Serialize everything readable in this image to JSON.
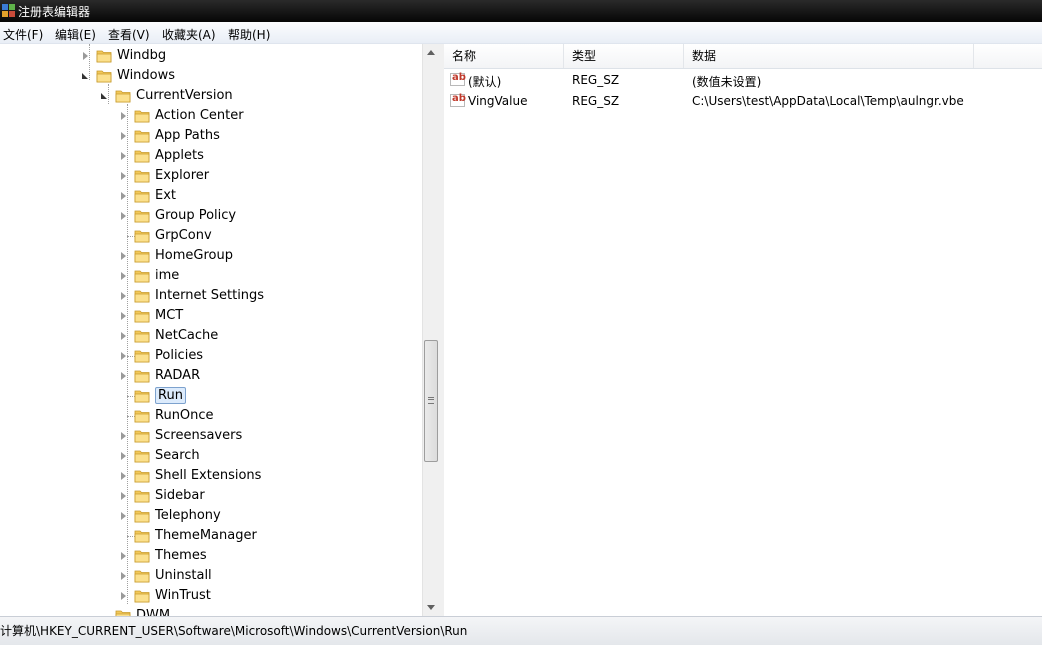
{
  "window": {
    "title": "注册表编辑器"
  },
  "menu": [
    {
      "label": "文件(F)"
    },
    {
      "label": "编辑(E)"
    },
    {
      "label": "查看(V)"
    },
    {
      "label": "收藏夹(A)"
    },
    {
      "label": "帮助(H)"
    }
  ],
  "tree": {
    "items": [
      {
        "label": "Windbg",
        "state": "collapsed"
      },
      {
        "label": "Windows",
        "state": "expanded"
      },
      {
        "label": "CurrentVersion",
        "state": "expanded"
      },
      {
        "label": "Action Center",
        "state": "collapsed"
      },
      {
        "label": "App Paths",
        "state": "collapsed"
      },
      {
        "label": "Applets",
        "state": "collapsed"
      },
      {
        "label": "Explorer",
        "state": "collapsed"
      },
      {
        "label": "Ext",
        "state": "collapsed"
      },
      {
        "label": "Group Policy",
        "state": "collapsed"
      },
      {
        "label": "GrpConv",
        "state": "leaf"
      },
      {
        "label": "HomeGroup",
        "state": "collapsed"
      },
      {
        "label": "ime",
        "state": "collapsed"
      },
      {
        "label": "Internet Settings",
        "state": "collapsed"
      },
      {
        "label": "MCT",
        "state": "collapsed"
      },
      {
        "label": "NetCache",
        "state": "collapsed"
      },
      {
        "label": "Policies",
        "state": "collapsed"
      },
      {
        "label": "RADAR",
        "state": "collapsed"
      },
      {
        "label": "Run",
        "state": "leaf",
        "selected": true
      },
      {
        "label": "RunOnce",
        "state": "leaf"
      },
      {
        "label": "Screensavers",
        "state": "collapsed"
      },
      {
        "label": "Search",
        "state": "collapsed"
      },
      {
        "label": "Shell Extensions",
        "state": "collapsed"
      },
      {
        "label": "Sidebar",
        "state": "collapsed"
      },
      {
        "label": "Telephony",
        "state": "collapsed"
      },
      {
        "label": "ThemeManager",
        "state": "leaf"
      },
      {
        "label": "Themes",
        "state": "collapsed"
      },
      {
        "label": "Uninstall",
        "state": "collapsed"
      },
      {
        "label": "WinTrust",
        "state": "collapsed"
      },
      {
        "label": "DWM",
        "state": "leaf"
      }
    ]
  },
  "list": {
    "columns": [
      {
        "label": "名称"
      },
      {
        "label": "类型"
      },
      {
        "label": "数据"
      }
    ],
    "rows": [
      {
        "name": "(默认)",
        "type": "REG_SZ",
        "data": "(数值未设置)",
        "icon": "string-value-icon"
      },
      {
        "name": "VingValue",
        "type": "REG_SZ",
        "data": "C:\\Users\\test\\AppData\\Local\\Temp\\aulngr.vbe",
        "icon": "string-value-icon"
      }
    ]
  },
  "status": {
    "path": "计算机\\HKEY_CURRENT_USER\\Software\\Microsoft\\Windows\\CurrentVersion\\Run"
  },
  "colors": {
    "titlebar": "#0a0a0a",
    "selection": "#dcebfc",
    "folder": "#f2c85b"
  }
}
